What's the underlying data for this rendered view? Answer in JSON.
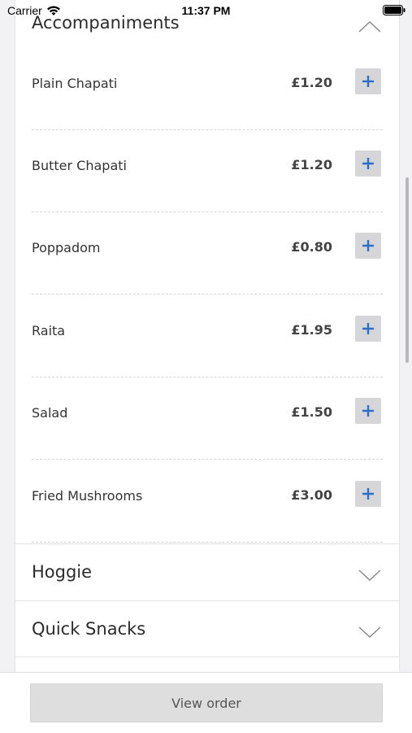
{
  "status_bar": {
    "carrier": "Carrier",
    "time": "11:37 PM"
  },
  "colors": {
    "accent": "#2f6fc9",
    "button_bg": "#d6d6d8"
  },
  "menu": {
    "expanded_section": {
      "title": "Accompaniments",
      "chevron": "chevron-up-icon",
      "items": [
        {
          "name": "Plain Chapati",
          "price": "£1.20",
          "add_icon": "plus-icon"
        },
        {
          "name": "Butter Chapati",
          "price": "£1.20",
          "add_icon": "plus-icon"
        },
        {
          "name": "Poppadom",
          "price": "£0.80",
          "add_icon": "plus-icon"
        },
        {
          "name": "Raita",
          "price": "£1.95",
          "add_icon": "plus-icon"
        },
        {
          "name": "Salad",
          "price": "£1.50",
          "add_icon": "plus-icon"
        },
        {
          "name": "Fried Mushrooms",
          "price": "£3.00",
          "add_icon": "plus-icon"
        }
      ]
    },
    "collapsed_sections": [
      {
        "title": "Hoggie",
        "chevron": "chevron-down-icon"
      },
      {
        "title": "Quick Snacks",
        "chevron": "chevron-down-icon"
      }
    ]
  },
  "footer": {
    "view_order_label": "View order"
  }
}
